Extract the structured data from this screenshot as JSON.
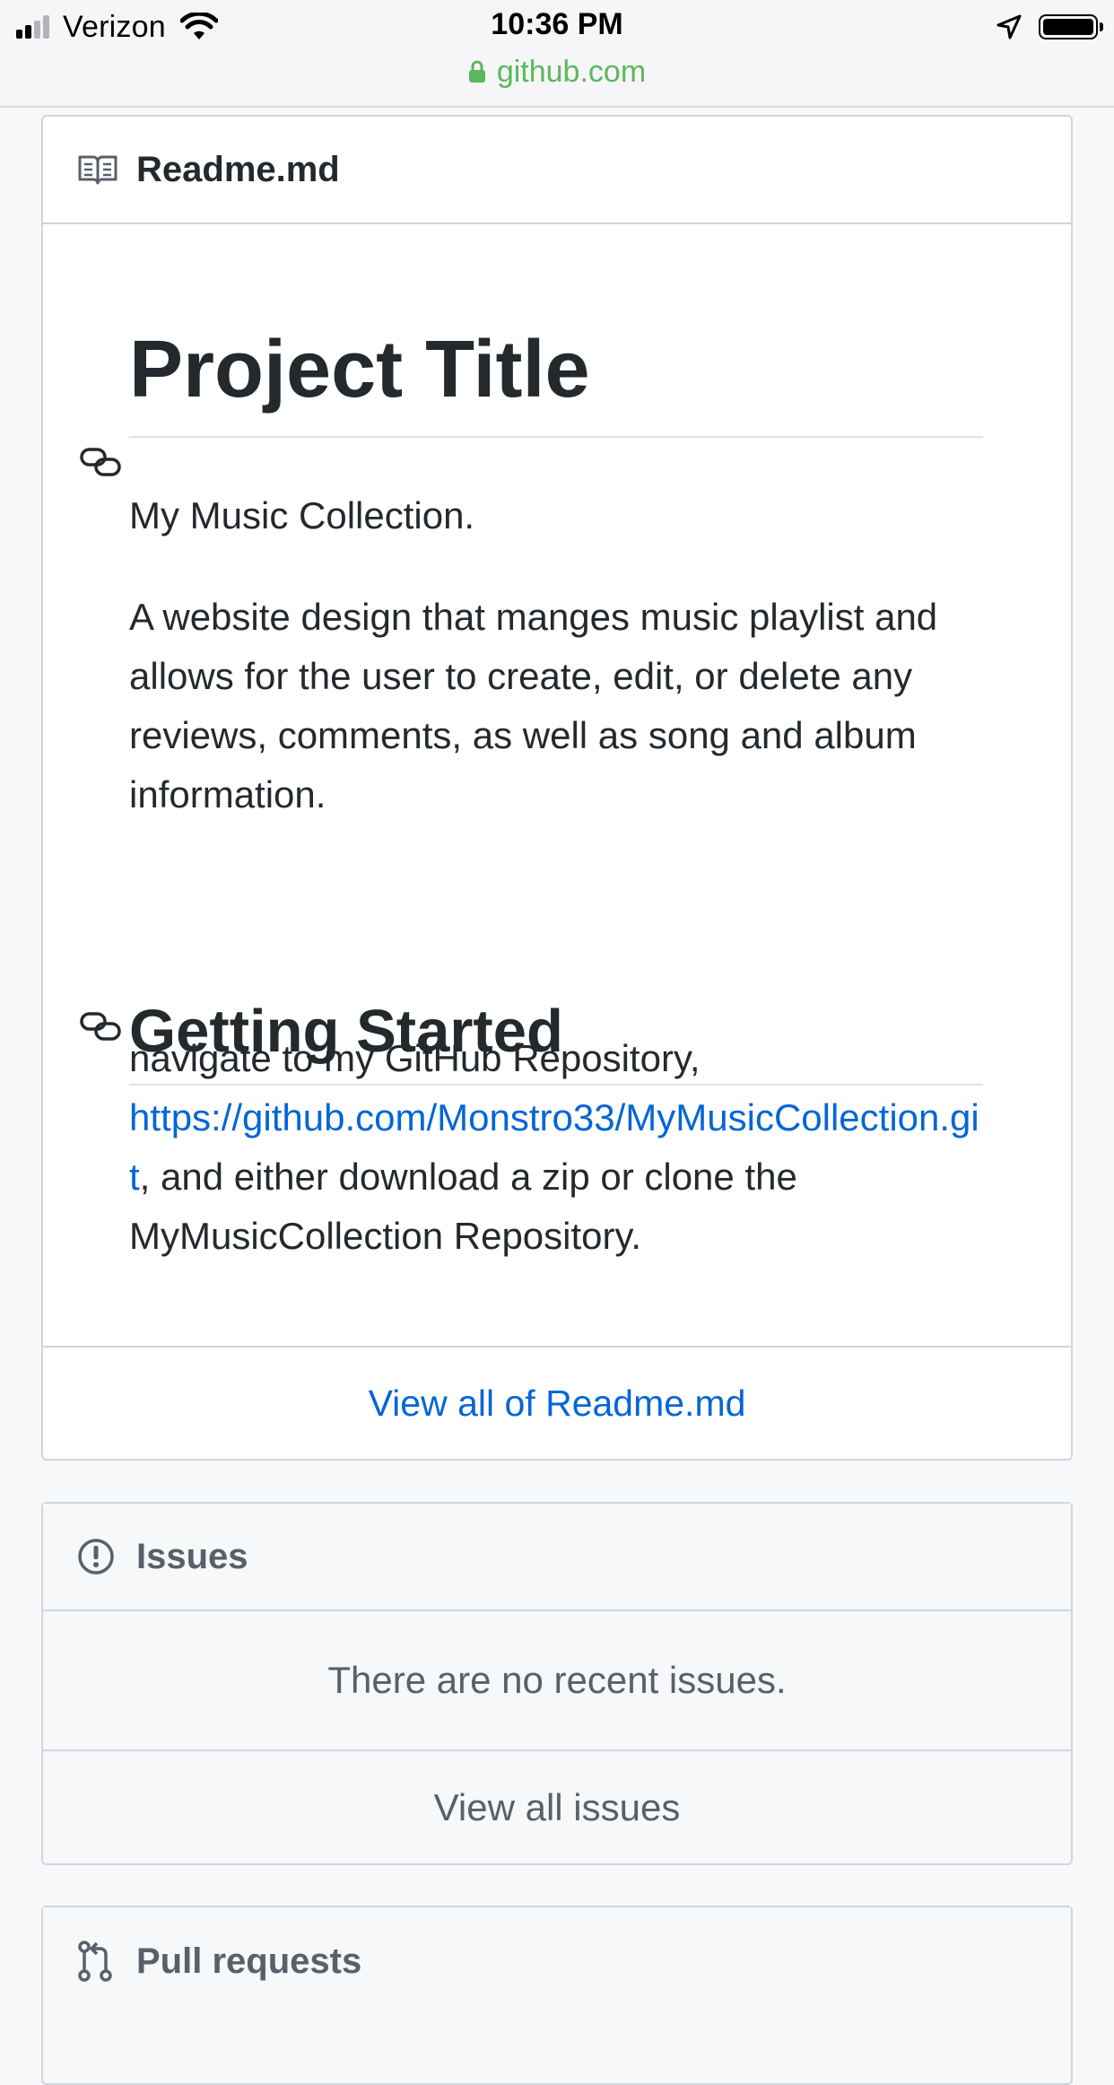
{
  "status_bar": {
    "carrier": "Verizon",
    "time": "10:36 PM",
    "battery_level": 0.95,
    "signal_bars_active": 2
  },
  "url_bar": {
    "domain": "github.com",
    "secure_color": "#5bb85d"
  },
  "readme": {
    "filename": "Readme.md",
    "header_icon": "book-icon",
    "heading1": "Project Title",
    "paragraph1": "My Music Collection.",
    "paragraph2": "A website design that manges music playlist and allows for the user to create, edit, or delete any reviews, comments, as well as song and album information.",
    "heading2": "Getting Started",
    "paragraph3_prefix": "navigate to my GitHub Repository, ",
    "repo_link": "https://github.com/Monstro33/MyMusicCollection.git",
    "paragraph3_suffix": ", and either download a zip or clone the MyMusicCollection Repository.",
    "anchor_icon": "link-icon",
    "view_all_label": "View all of Readme.md"
  },
  "issues": {
    "title": "Issues",
    "icon": "issue-opened-icon",
    "empty_message": "There are no recent issues.",
    "view_all_label": "View all issues"
  },
  "pull_requests": {
    "title": "Pull requests",
    "icon": "git-pull-request-icon"
  },
  "colors": {
    "link": "#0366d6",
    "text": "#24292e",
    "muted": "#586069",
    "border": "#d1d5da",
    "page_bg": "#f6f8fa"
  }
}
